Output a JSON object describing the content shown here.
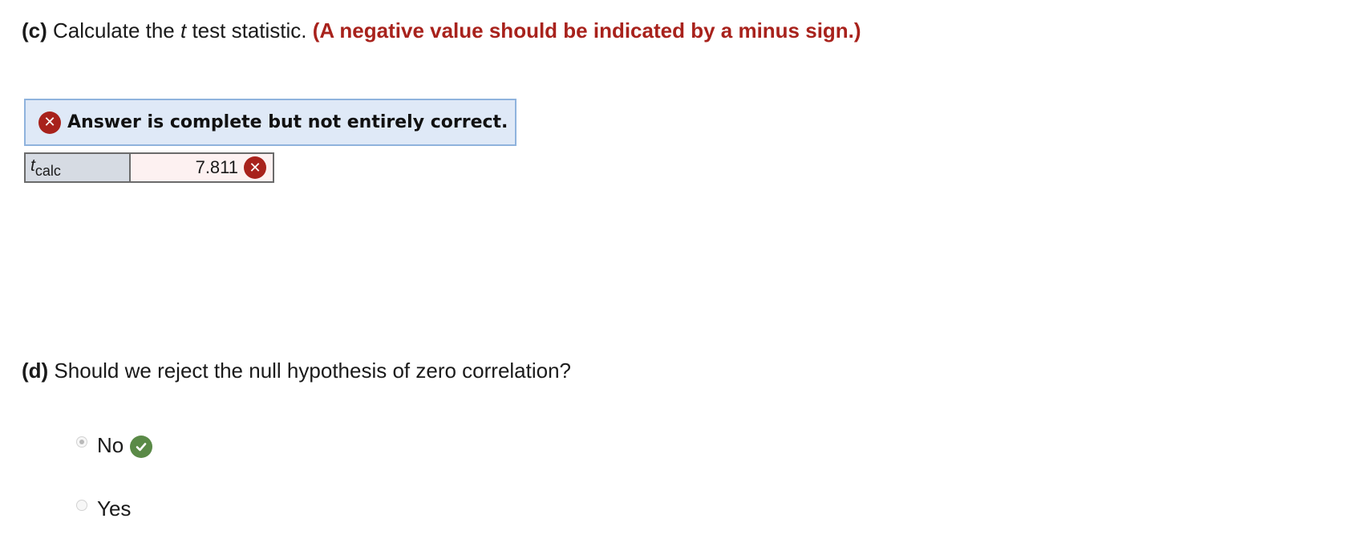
{
  "part_c": {
    "label": "(c)",
    "text_before": " Calculate the ",
    "t_var": "t",
    "text_after": " test statistic. ",
    "note": "(A negative value should be indicated by a minus sign.)"
  },
  "feedback": {
    "banner_icon": "x-circle-icon",
    "banner_text": "Answer is complete but not entirely correct."
  },
  "answer_table": {
    "var_name": "t",
    "var_subscript": "calc",
    "value": "7.811",
    "status_icon": "x-circle-icon"
  },
  "part_d": {
    "label": "(d)",
    "text": " Should we reject the null hypothesis of zero correlation?"
  },
  "options": [
    {
      "label": "No",
      "selected": true,
      "status_icon": "check-circle-icon"
    },
    {
      "label": "Yes",
      "selected": false
    }
  ],
  "colors": {
    "error_red": "#a8221c",
    "banner_bg": "#dfe9f7",
    "banner_border": "#8fb3dd",
    "correct_green": "#5a8a47"
  }
}
